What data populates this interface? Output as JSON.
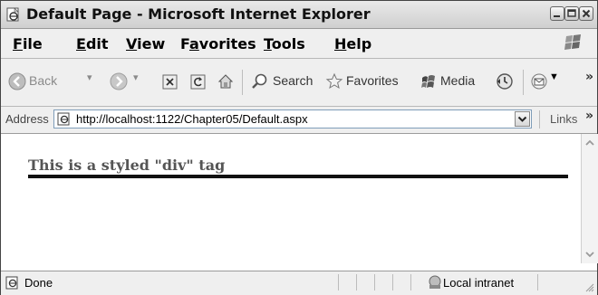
{
  "window": {
    "title": "Default Page - Microsoft Internet Explorer"
  },
  "menu": {
    "items": [
      {
        "label": "File",
        "accel": "F",
        "rest": "ile"
      },
      {
        "label": "Edit",
        "accel": "E",
        "rest": "dit"
      },
      {
        "label": "View",
        "accel": "V",
        "rest": "iew"
      },
      {
        "label": "Favorites",
        "pre": "F",
        "accel": "a",
        "rest": "vorites"
      },
      {
        "label": "Tools",
        "accel": "T",
        "rest": "ools"
      },
      {
        "label": "Help",
        "accel": "H",
        "rest": "elp"
      }
    ]
  },
  "toolbar": {
    "back_label": "Back",
    "search_label": "Search",
    "favorites_label": "Favorites",
    "media_label": "Media",
    "overflow": "»"
  },
  "address": {
    "label": "Address",
    "url": "http://localhost:1122/Chapter05/Default.aspx",
    "links_label": "Links",
    "links_overflow": "»"
  },
  "content": {
    "div_text": "This is a styled \"div\" tag"
  },
  "status": {
    "text": "Done",
    "zone": "Local intranet"
  }
}
